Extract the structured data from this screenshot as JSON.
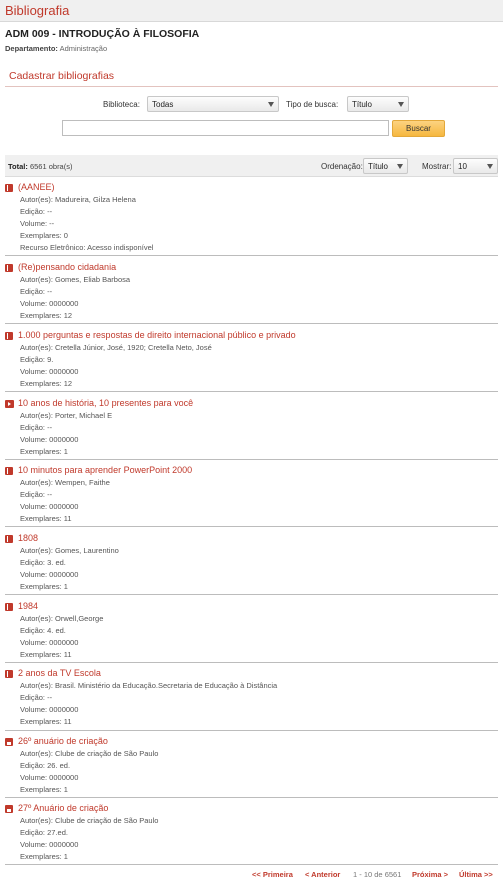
{
  "app_title": "Bibliografia",
  "course_title": "ADM 009 - INTRODUÇÃO À FILOSOFIA",
  "department_label": "Departamento:",
  "department_value": "Administração",
  "section_title": "Cadastrar bibliografias",
  "form": {
    "library_label": "Biblioteca:",
    "library_value": "Todas",
    "search_type_label": "Tipo de busca:",
    "search_type_value": "Título",
    "search_value": "",
    "search_button": "Buscar"
  },
  "results": {
    "total_label": "Total:",
    "total_value": "6561 obra(s)",
    "sort_label": "Ordenação:",
    "sort_value": "Título",
    "show_label": "Mostrar:",
    "show_value": "10"
  },
  "items": [
    {
      "icon": "book-icon",
      "title": "(AANEE)",
      "lines": [
        "Autor(es): Madureira, Gilza Helena",
        "Edição: --",
        "Volume: --",
        "Exemplares: 0",
        "Recurso Eletrônico: Acesso indisponível"
      ]
    },
    {
      "icon": "book-icon",
      "title": "(Re)pensando cidadania",
      "lines": [
        "Autor(es): Gomes, Eliab Barbosa",
        "Edição: --",
        "Volume: 0000000",
        "Exemplares: 12"
      ]
    },
    {
      "icon": "book-icon",
      "title": "1.000 perguntas e respostas de direito internacional público e privado",
      "lines": [
        "Autor(es): Cretella Júnior, José, 1920; Cretella Neto, José",
        "Edição: 9.",
        "Volume: 0000000",
        "Exemplares: 12"
      ]
    },
    {
      "icon": "media-icon",
      "title": "10 anos de história, 10 presentes para você",
      "lines": [
        "Autor(es): Porter, Michael E",
        "Edição: --",
        "Volume: 0000000",
        "Exemplares: 1"
      ]
    },
    {
      "icon": "book-icon",
      "title": "10 minutos para aprender PowerPoint 2000",
      "lines": [
        "Autor(es): Wempen, Faithe",
        "Edição: --",
        "Volume: 0000000",
        "Exemplares: 11"
      ]
    },
    {
      "icon": "book-icon",
      "title": "1808",
      "lines": [
        "Autor(es): Gomes, Laurentino",
        "Edição: 3. ed.",
        "Volume: 0000000",
        "Exemplares: 1"
      ]
    },
    {
      "icon": "book-icon",
      "title": "1984",
      "lines": [
        "Autor(es): Orwell,George",
        "Edição: 4. ed.",
        "Volume: 0000000",
        "Exemplares: 11"
      ]
    },
    {
      "icon": "book-icon",
      "title": "2 anos da TV Escola",
      "lines": [
        "Autor(es): Brasil. Ministério da Educação.Secretaria de Educação à Distância",
        "Edição: --",
        "Volume: 0000000",
        "Exemplares: 11"
      ]
    },
    {
      "icon": "save-icon",
      "title": "26º anuário de criação",
      "lines": [
        "Autor(es): Clube de criação de São Paulo",
        "Edição: 26. ed.",
        "Volume: 0000000",
        "Exemplares: 1"
      ]
    },
    {
      "icon": "save-icon",
      "title": "27º Anuário de criação",
      "lines": [
        "Autor(es): Clube de criação de São Paulo",
        "Edição: 27.ed.",
        "Volume: 0000000",
        "Exemplares: 1"
      ]
    }
  ],
  "pagination": {
    "first": "<< Primeira",
    "previous": "< Anterior",
    "info": "1 - 10 de 6561",
    "next": "Próxima >",
    "last": "Última >>"
  },
  "colors": {
    "accent": "#c0392b",
    "button": "#f6b73f",
    "header_bg": "#f0f0f0"
  }
}
